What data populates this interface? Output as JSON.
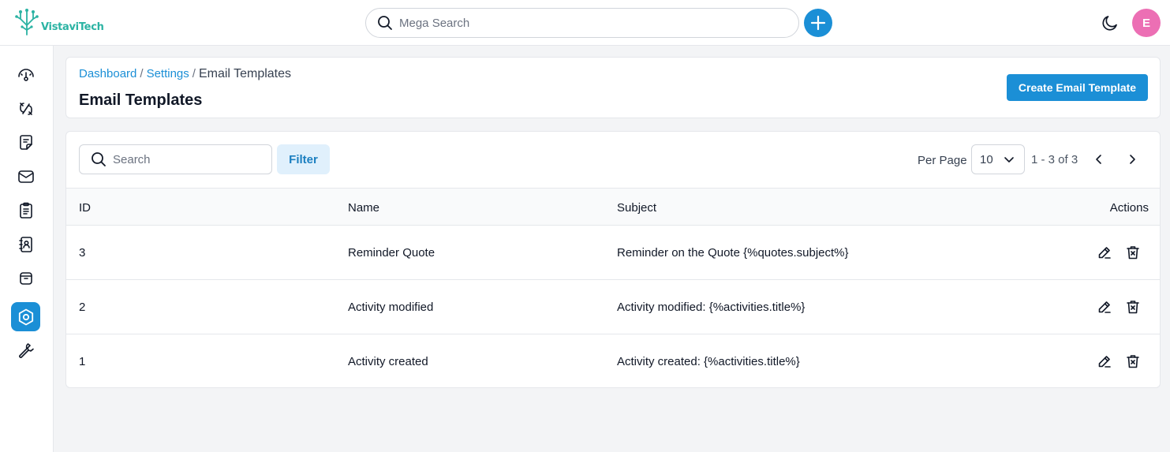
{
  "app": {
    "logo_text": "VistaviTech"
  },
  "topbar": {
    "search_placeholder": "Mega Search",
    "avatar_initial": "E"
  },
  "sidebar": {
    "items": [
      {
        "name": "sidebar-item-dashboard",
        "icon": "gauge-icon",
        "active": false
      },
      {
        "name": "sidebar-item-deals",
        "icon": "link-icon",
        "active": false
      },
      {
        "name": "sidebar-item-notes",
        "icon": "note-icon",
        "active": false
      },
      {
        "name": "sidebar-item-inbox",
        "icon": "mail-icon",
        "active": false
      },
      {
        "name": "sidebar-item-activities",
        "icon": "clipboard-icon",
        "active": false
      },
      {
        "name": "sidebar-item-contacts",
        "icon": "contact-book-icon",
        "active": false
      },
      {
        "name": "sidebar-item-archive",
        "icon": "archive-icon",
        "active": false
      },
      {
        "name": "sidebar-item-settings",
        "icon": "settings-icon",
        "active": true
      },
      {
        "name": "sidebar-item-tools",
        "icon": "wrench-icon",
        "active": false
      }
    ]
  },
  "header": {
    "breadcrumb": [
      "Dashboard",
      "Settings",
      "Email Templates"
    ],
    "separator": "/",
    "title": "Email Templates",
    "create_label": "Create Email Template"
  },
  "toolbar": {
    "search_placeholder": "Search",
    "filter_label": "Filter",
    "per_page_label": "Per Page",
    "per_page_value": "10",
    "range_text": "1 - 3 of 3"
  },
  "table": {
    "columns": [
      "ID",
      "Name",
      "Subject",
      "Actions"
    ],
    "rows": [
      {
        "id": "3",
        "name": "Reminder Quote",
        "subject": "Reminder on the Quote {%quotes.subject%}"
      },
      {
        "id": "2",
        "name": "Activity modified",
        "subject": "Activity modified: {%activities.title%}"
      },
      {
        "id": "1",
        "name": "Activity created",
        "subject": "Activity created: {%activities.title%}"
      }
    ]
  },
  "colors": {
    "accent": "#1b8fd6",
    "logo": "#2bb3a3",
    "avatar": "#ec6fb4",
    "filter_bg": "#e0f0fc"
  }
}
